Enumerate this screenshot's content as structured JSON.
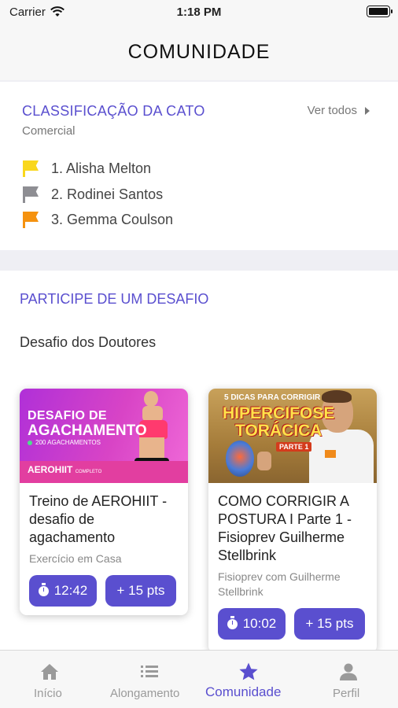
{
  "status_bar": {
    "carrier": "Carrier",
    "time": "1:18 PM"
  },
  "header": {
    "title": "COMUNIDADE"
  },
  "ranking": {
    "title": "CLASSIFICAÇÃO DA CATO",
    "subtitle": "Comercial",
    "see_all": "Ver todos",
    "items": [
      {
        "label": "1. Alisha Melton",
        "flag_color": "#f9d71c"
      },
      {
        "label": "2. Rodinei Santos",
        "flag_color": "#8e8e93"
      },
      {
        "label": "3. Gemma Coulson",
        "flag_color": "#f5920f"
      }
    ]
  },
  "challenge": {
    "title": "PARTICIPE DE UM DESAFIO",
    "subtitle": "Desafio dos Doutores",
    "cards": [
      {
        "thumb": {
          "line1": "DESAFIO DE",
          "line2": "AGACHAMENTO",
          "line3": "200 AGACHAMENTOS",
          "line4": "AEROHIIT",
          "line4_small": "COMPLETO"
        },
        "title": "Treino de AEROHIIT - desafio de agachamento",
        "subtitle": "Exercício em Casa",
        "duration": "12:42",
        "points": "+ 15 pts"
      },
      {
        "thumb": {
          "line1": "5 DICAS PARA CORRIGIR",
          "line2": "HIPERCIFOSE",
          "line3": "TORÁCICA",
          "line4": "PARTE 1"
        },
        "title": "COMO CORRIGIR A POSTURA I Parte 1 - Fisioprev Guilherme Stellbrink",
        "subtitle": "Fisioprev com Guilherme Stellbrink",
        "duration": "10:02",
        "points": "+ 15 pts"
      }
    ]
  },
  "tab_bar": {
    "tabs": [
      {
        "label": "Início",
        "icon": "home-icon"
      },
      {
        "label": "Alongamento",
        "icon": "list-icon"
      },
      {
        "label": "Comunidade",
        "icon": "star-icon",
        "active": true
      },
      {
        "label": "Perfil",
        "icon": "person-icon"
      }
    ]
  },
  "colors": {
    "accent": "#5a4fcf",
    "background": "#efeff4"
  }
}
